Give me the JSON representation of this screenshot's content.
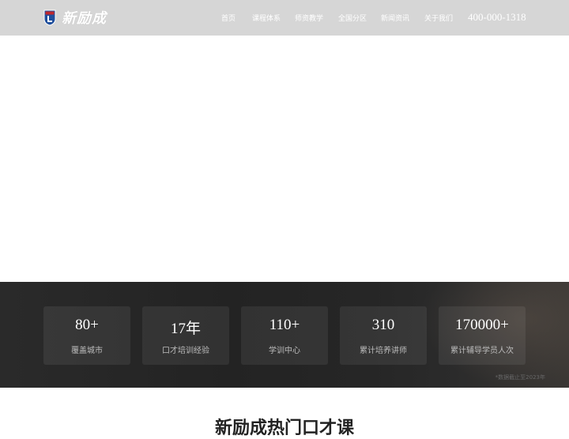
{
  "header": {
    "logo_text": "新励成",
    "nav": [
      "首页",
      "课程体系",
      "师资教学",
      "全国分区",
      "新闻资讯",
      "关于我们"
    ],
    "phone": "400-000-1318"
  },
  "stats": {
    "items": [
      {
        "value": "80+",
        "label": "覆盖城市"
      },
      {
        "value": "17年",
        "label": "口才培训经验"
      },
      {
        "value": "110+",
        "label": "学训中心"
      },
      {
        "value": "310",
        "label": "累计培养讲师"
      },
      {
        "value": "170000+",
        "label": "累计辅导学员人次"
      }
    ],
    "note": "*数据截止至2023年"
  },
  "section": {
    "title": "新励成热门口才课"
  },
  "colors": {
    "header_bg": "#d6d6d6",
    "stats_bg": "#262626",
    "badge_blue": "#1f4e9c",
    "badge_red": "#c0272d"
  }
}
